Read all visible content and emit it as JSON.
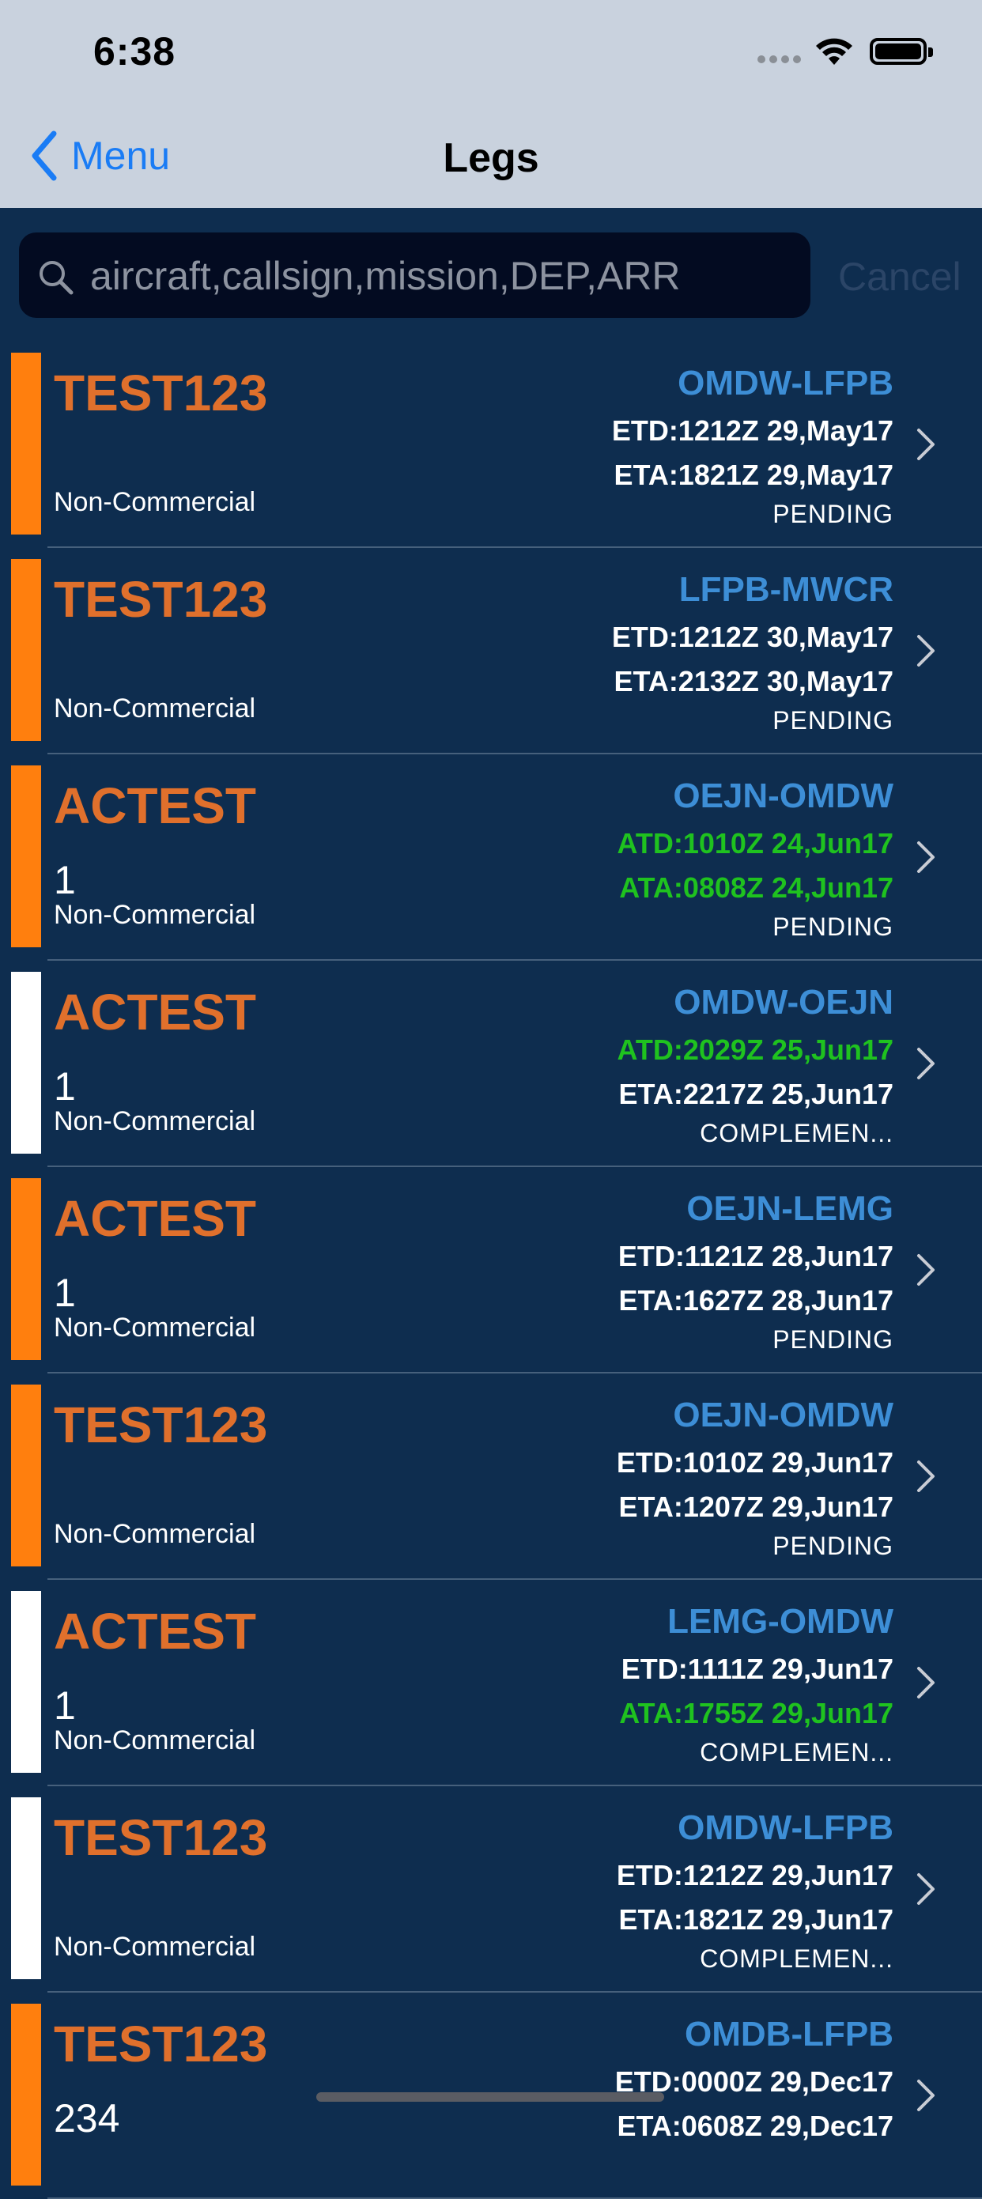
{
  "status_bar": {
    "time": "6:38"
  },
  "nav": {
    "back_label": "Menu",
    "title": "Legs"
  },
  "search": {
    "placeholder": "aircraft,callsign,mission,DEP,ARR",
    "value": "",
    "cancel_label": "Cancel"
  },
  "colors": {
    "background": "#0e2d4f",
    "callsign": "#e0702c",
    "route": "#3d8ed6",
    "actual_time": "#1fc21f",
    "scheduled_time": "#ffffff",
    "bar_orange": "#ff7f0e",
    "bar_white": "#ffffff"
  },
  "legs": [
    {
      "callsign": "TEST123",
      "flight": "",
      "type": "Non-Commercial",
      "route": "OMDW-LFPB",
      "time1": "ETD:1212Z 29,May17",
      "time1_actual": false,
      "time2": "ETA:1821Z 29,May17",
      "time2_actual": false,
      "status": "PENDING",
      "bar": "orange"
    },
    {
      "callsign": "TEST123",
      "flight": "",
      "type": "Non-Commercial",
      "route": "LFPB-MWCR",
      "time1": "ETD:1212Z 30,May17",
      "time1_actual": false,
      "time2": "ETA:2132Z 30,May17",
      "time2_actual": false,
      "status": "PENDING",
      "bar": "orange"
    },
    {
      "callsign": "ACTEST",
      "flight": "1",
      "type": "Non-Commercial",
      "route": "OEJN-OMDW",
      "time1": "ATD:1010Z 24,Jun17",
      "time1_actual": true,
      "time2": "ATA:0808Z 24,Jun17",
      "time2_actual": true,
      "status": "PENDING",
      "bar": "orange"
    },
    {
      "callsign": "ACTEST",
      "flight": "1",
      "type": "Non-Commercial",
      "route": "OMDW-OEJN",
      "time1": "ATD:2029Z 25,Jun17",
      "time1_actual": true,
      "time2": "ETA:2217Z 25,Jun17",
      "time2_actual": false,
      "status": "COMPLEMEN...",
      "bar": "white"
    },
    {
      "callsign": "ACTEST",
      "flight": "1",
      "type": "Non-Commercial",
      "route": "OEJN-LEMG",
      "time1": "ETD:1121Z 28,Jun17",
      "time1_actual": false,
      "time2": "ETA:1627Z 28,Jun17",
      "time2_actual": false,
      "status": "PENDING",
      "bar": "orange"
    },
    {
      "callsign": "TEST123",
      "flight": "",
      "type": "Non-Commercial",
      "route": "OEJN-OMDW",
      "time1": "ETD:1010Z 29,Jun17",
      "time1_actual": false,
      "time2": "ETA:1207Z 29,Jun17",
      "time2_actual": false,
      "status": "PENDING",
      "bar": "orange"
    },
    {
      "callsign": "ACTEST",
      "flight": "1",
      "type": "Non-Commercial",
      "route": "LEMG-OMDW",
      "time1": "ETD:1111Z 29,Jun17",
      "time1_actual": false,
      "time2": "ATA:1755Z 29,Jun17",
      "time2_actual": true,
      "status": "COMPLEMEN...",
      "bar": "white"
    },
    {
      "callsign": "TEST123",
      "flight": "",
      "type": "Non-Commercial",
      "route": "OMDW-LFPB",
      "time1": "ETD:1212Z 29,Jun17",
      "time1_actual": false,
      "time2": "ETA:1821Z 29,Jun17",
      "time2_actual": false,
      "status": "COMPLEMEN...",
      "bar": "white"
    },
    {
      "callsign": "TEST123",
      "flight": "234",
      "type": "",
      "route": "OMDB-LFPB",
      "time1": "ETD:0000Z 29,Dec17",
      "time1_actual": false,
      "time2": "ETA:0608Z 29,Dec17",
      "time2_actual": false,
      "status": "",
      "bar": "orange"
    }
  ]
}
